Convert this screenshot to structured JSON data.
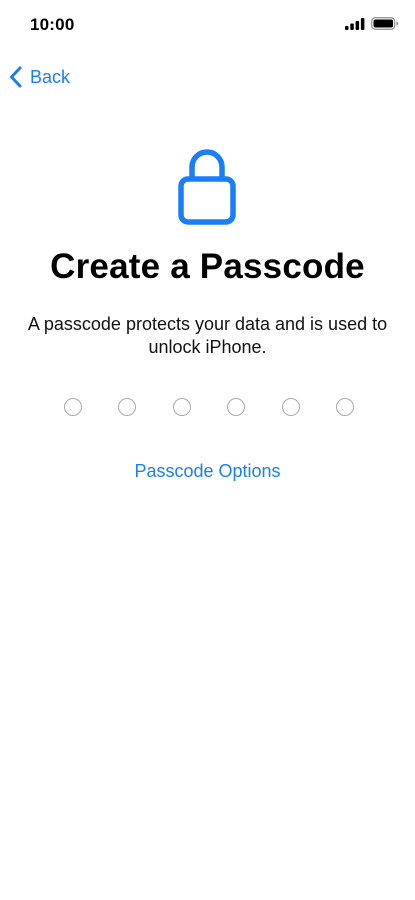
{
  "status_bar": {
    "time": "10:00"
  },
  "nav": {
    "back_label": "Back"
  },
  "main": {
    "title": "Create a Passcode",
    "subtitle": "A passcode protects your data and is used to unlock iPhone.",
    "passcode_length": 6,
    "passcode_entered": 0,
    "options_label": "Passcode Options"
  },
  "colors": {
    "accent": "#1a7ef5",
    "dot_border": "#a9a9ae"
  },
  "icons": {
    "signal": "cellular-signal-icon",
    "battery": "battery-icon",
    "back": "chevron-left-icon",
    "lock": "lock-icon"
  }
}
